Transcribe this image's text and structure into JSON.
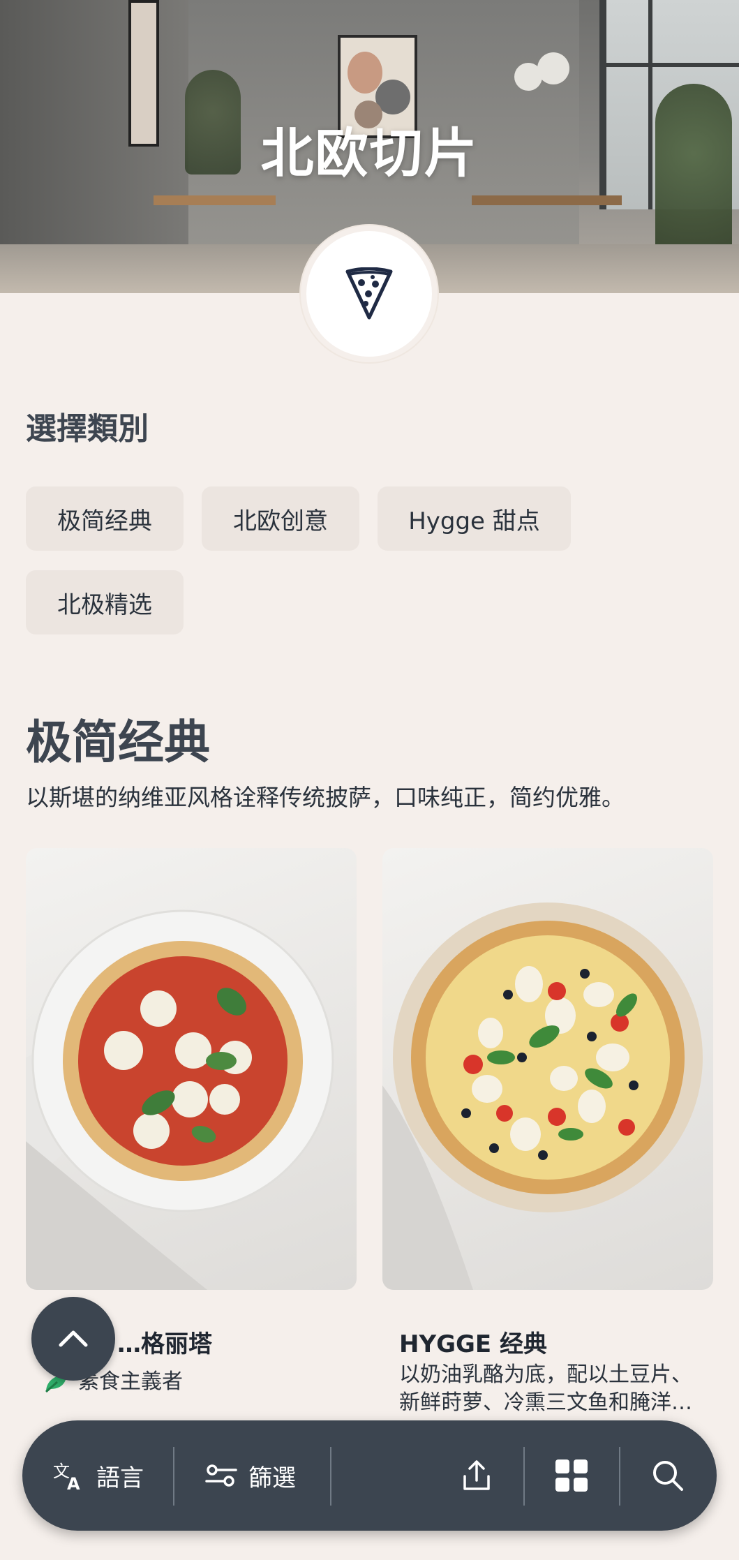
{
  "header": {
    "title": "北欧切片"
  },
  "category_section": {
    "label": "選擇類別",
    "chips": [
      "极简经典",
      "北欧创意",
      "Hygge 甜点",
      "北极精选"
    ]
  },
  "category": {
    "title": "极简经典",
    "description": "以斯堪的纳维亚风格诠释传统披萨，口味纯正，简约优雅。"
  },
  "products": [
    {
      "name": "…格丽塔",
      "tag": "素食主義者"
    },
    {
      "name": "HYGGE 经典",
      "description_line1": "以奶油乳酪为底，配以土豆片、",
      "description_line2": "新鲜莳萝、冷熏三文鱼和腌洋…"
    }
  ],
  "bottom_bar": {
    "language_label": "語言",
    "filter_label": "篩選"
  },
  "icons": {
    "logo": "pizza-slice-icon",
    "scroll_top": "chevron-up-icon",
    "language": "translate-icon",
    "filter": "sliders-icon",
    "share": "share-icon",
    "grid": "grid-icon",
    "search": "search-icon"
  },
  "colors": {
    "background": "#f5efeb",
    "chip": "#ece5e0",
    "bar": "#3c4550",
    "text": "#2a323c",
    "vegetarian": "#2fae6a"
  }
}
